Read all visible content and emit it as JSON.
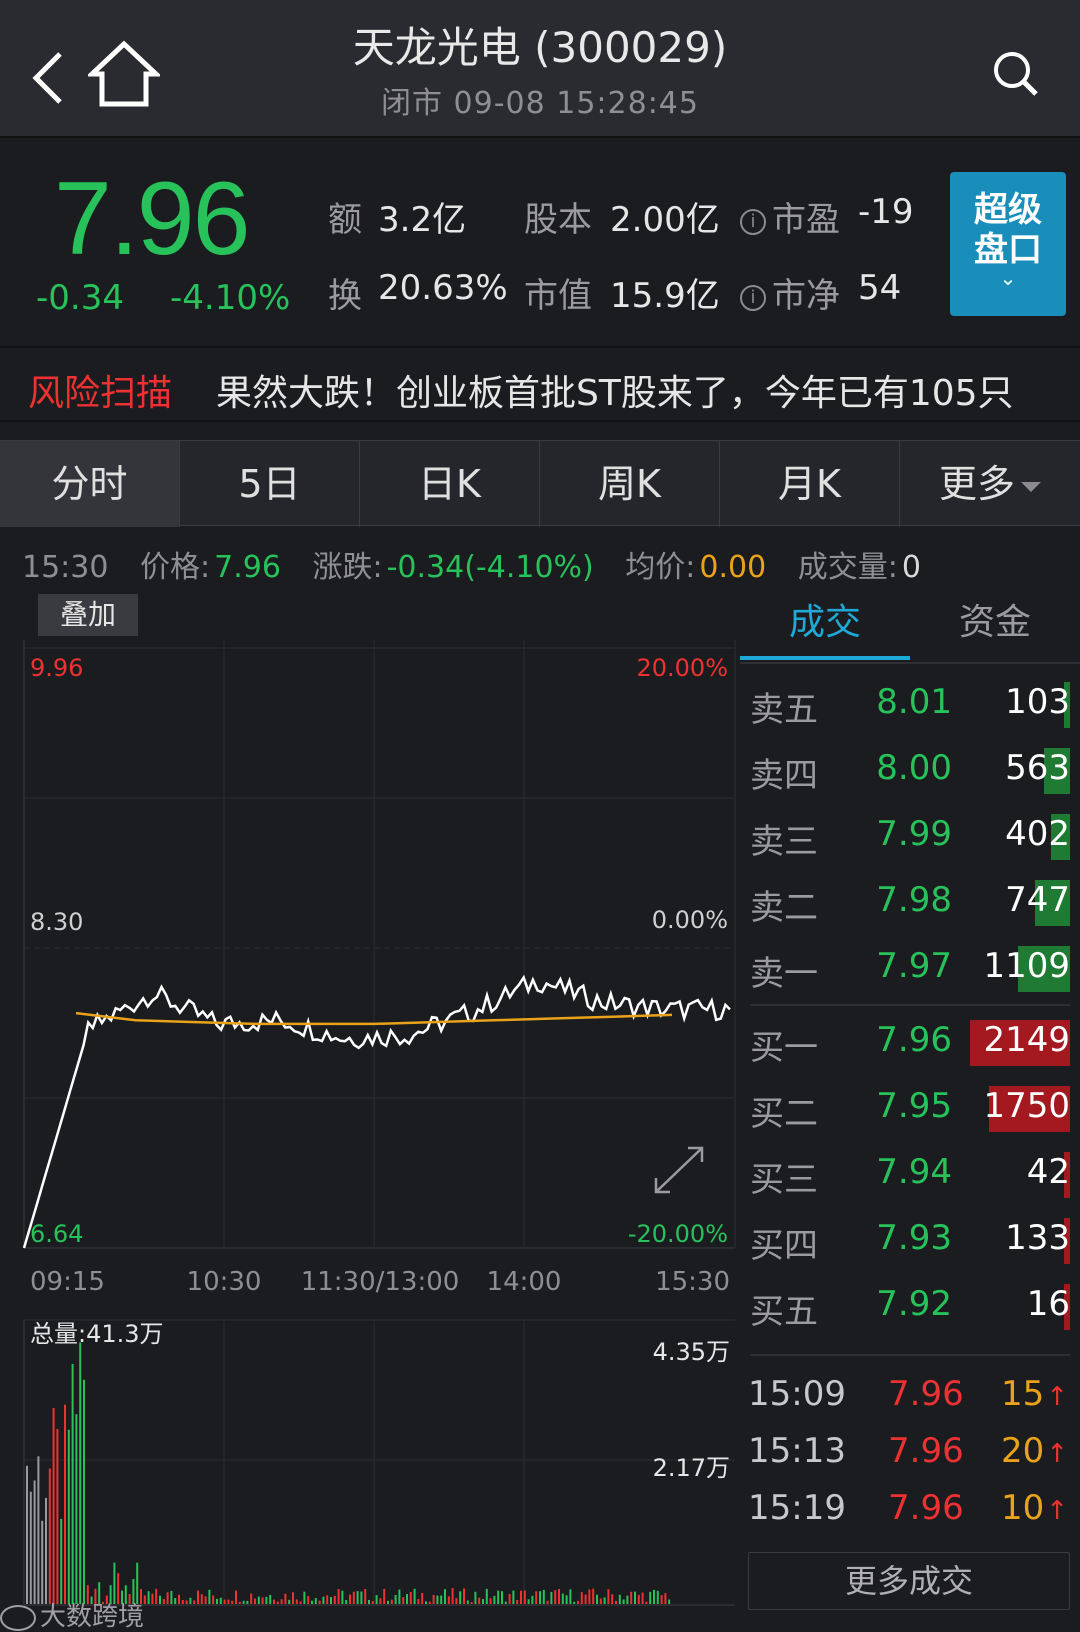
{
  "header": {
    "title": "天龙光电 (300029)",
    "status": "闭市 09-08 15:28:45"
  },
  "quote": {
    "price": "7.96",
    "change": "-0.34",
    "change_pct": "-4.10%",
    "amount_label": "额",
    "amount": "3.2亿",
    "turnover_label": "换",
    "turnover": "20.63%",
    "shares_label": "股本",
    "shares": "2.00亿",
    "mktcap_label": "市值",
    "mktcap": "15.9亿",
    "pe_label": "市盈",
    "pe": "-19",
    "pb_label": "市净",
    "pb": "54",
    "super_line1": "超级",
    "super_line2": "盘口",
    "super_caret": "⌄"
  },
  "risk": {
    "label": "风险扫描",
    "text": "果然大跌！创业板首批ST股来了，今年已有105只"
  },
  "tabs": [
    "分时",
    "5日",
    "日K",
    "周K",
    "月K",
    "更多"
  ],
  "inforow": {
    "time": "15:30",
    "price_label": "价格:",
    "price": "7.96",
    "change_label": "涨跌:",
    "change": "-0.34(-4.10%)",
    "avg_label": "均价:",
    "avg": "0.00",
    "vol_label": "成交量:",
    "vol": "0"
  },
  "chart": {
    "overlay_button": "叠加",
    "y_high": "9.96",
    "y_mid": "8.30",
    "y_low": "6.64",
    "pct_high": "20.00%",
    "pct_mid": "0.00%",
    "pct_low": "-20.00%",
    "x_labels": [
      "09:15",
      "10:30",
      "11:30/13:00",
      "14:00",
      "15:30"
    ],
    "volume_total": "总量:41.3万",
    "volume_high": "4.35万",
    "volume_mid": "2.17万",
    "colors": {
      "price_line": "#ffffff",
      "avg_line": "#e9a21a",
      "up": "#ee3131",
      "down": "#28c25a"
    }
  },
  "chart_data": {
    "type": "line",
    "x": [
      "09:15",
      "10:30",
      "11:30/13:00",
      "14:00",
      "15:30"
    ],
    "ylim": [
      6.64,
      9.96
    ],
    "series": [
      {
        "values": [
          6.64,
          7.85,
          8.05,
          7.88,
          7.9,
          7.8,
          7.82,
          7.95,
          8.12,
          8.0,
          7.96,
          7.96
        ]
      },
      {
        "values": [
          7.94,
          7.9,
          7.89,
          7.88,
          7.88,
          7.88,
          7.89,
          7.9,
          7.91,
          7.92,
          7.93
        ]
      }
    ]
  },
  "right_tabs": [
    "成交",
    "资金"
  ],
  "orderbook": [
    {
      "name": "卖五",
      "price": "8.01",
      "vol": "103",
      "fill": 0.05,
      "side": "sell"
    },
    {
      "name": "卖四",
      "price": "8.00",
      "vol": "563",
      "fill": 0.26,
      "side": "sell"
    },
    {
      "name": "卖三",
      "price": "7.99",
      "vol": "402",
      "fill": 0.19,
      "side": "sell"
    },
    {
      "name": "卖二",
      "price": "7.98",
      "vol": "747",
      "fill": 0.35,
      "side": "sell"
    },
    {
      "name": "卖一",
      "price": "7.97",
      "vol": "1109",
      "fill": 0.52,
      "side": "sell"
    },
    {
      "name": "买一",
      "price": "7.96",
      "vol": "2149",
      "fill": 1.0,
      "side": "buy"
    },
    {
      "name": "买二",
      "price": "7.95",
      "vol": "1750",
      "fill": 0.81,
      "side": "buy"
    },
    {
      "name": "买三",
      "price": "7.94",
      "vol": "42",
      "fill": 0.02,
      "side": "buy"
    },
    {
      "name": "买四",
      "price": "7.93",
      "vol": "133",
      "fill": 0.06,
      "side": "buy"
    },
    {
      "name": "买五",
      "price": "7.92",
      "vol": "16",
      "fill": 0.01,
      "side": "buy"
    }
  ],
  "trades": [
    {
      "time": "15:09",
      "price": "7.96",
      "vol": "15"
    },
    {
      "time": "15:13",
      "price": "7.96",
      "vol": "20"
    },
    {
      "time": "15:19",
      "price": "7.96",
      "vol": "10"
    }
  ],
  "more_trades": "更多成交",
  "watermark": "大数跨境"
}
